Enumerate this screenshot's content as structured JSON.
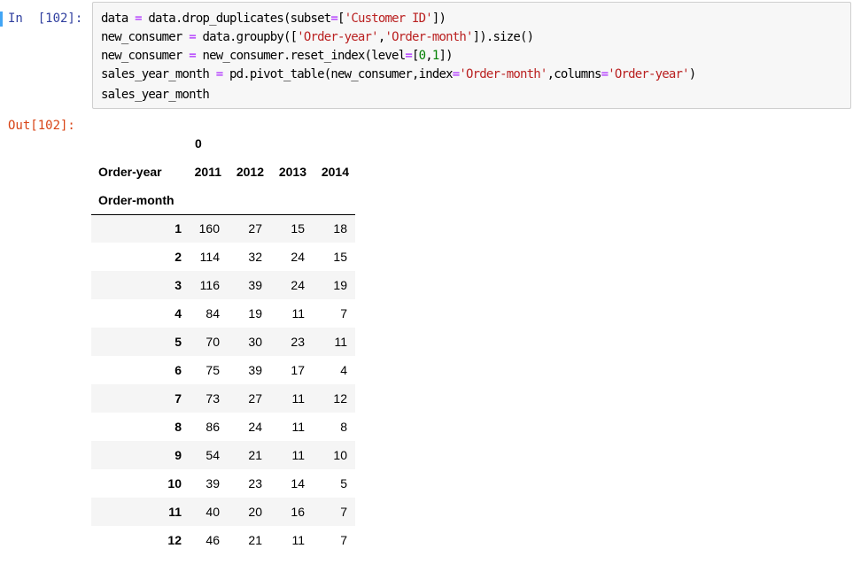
{
  "input_prompt": "In  [102]:",
  "output_prompt": "Out[102]:",
  "code": {
    "line1": {
      "a": "data ",
      "b": "=",
      "c": " data.drop_duplicates(subset",
      "d": "=",
      "e": "[",
      "f": "'Customer ID'",
      "g": "])"
    },
    "line2": {
      "a": "new_consumer ",
      "b": "=",
      "c": " data.groupby([",
      "d": "'Order-year'",
      "e": ",",
      "f": "'Order-month'",
      "g": "]).size()"
    },
    "line3": {
      "a": "new_consumer ",
      "b": "=",
      "c": " new_consumer.reset_index(level",
      "d": "=",
      "e": "[",
      "f": "0",
      "g": ",",
      "h": "1",
      "i": "])"
    },
    "line4": {
      "a": "sales_year_month ",
      "b": "=",
      "c": " pd.pivot_table(new_consumer,index",
      "d": "=",
      "e": "'Order-month'",
      "f": ",columns",
      "g": "=",
      "h": "'Order-year'",
      "i": ")"
    },
    "line5": "sales_year_month"
  },
  "table": {
    "level0_label": "0",
    "columns_name": "Order-year",
    "index_name": "Order-month",
    "columns": [
      "2011",
      "2012",
      "2013",
      "2014"
    ],
    "rows": [
      {
        "idx": "1",
        "v": [
          "160",
          "27",
          "15",
          "18"
        ]
      },
      {
        "idx": "2",
        "v": [
          "114",
          "32",
          "24",
          "15"
        ]
      },
      {
        "idx": "3",
        "v": [
          "116",
          "39",
          "24",
          "19"
        ]
      },
      {
        "idx": "4",
        "v": [
          "84",
          "19",
          "11",
          "7"
        ]
      },
      {
        "idx": "5",
        "v": [
          "70",
          "30",
          "23",
          "11"
        ]
      },
      {
        "idx": "6",
        "v": [
          "75",
          "39",
          "17",
          "4"
        ]
      },
      {
        "idx": "7",
        "v": [
          "73",
          "27",
          "11",
          "12"
        ]
      },
      {
        "idx": "8",
        "v": [
          "86",
          "24",
          "11",
          "8"
        ]
      },
      {
        "idx": "9",
        "v": [
          "54",
          "21",
          "11",
          "10"
        ]
      },
      {
        "idx": "10",
        "v": [
          "39",
          "23",
          "14",
          "5"
        ]
      },
      {
        "idx": "11",
        "v": [
          "40",
          "20",
          "16",
          "7"
        ]
      },
      {
        "idx": "12",
        "v": [
          "46",
          "21",
          "11",
          "7"
        ]
      }
    ]
  },
  "colors": {
    "input_prompt": "#303f9f",
    "output_prompt": "#d84315",
    "cell_marker": "#42a5f5",
    "code_bg": "#f7f7f7",
    "operator": "#aa22ff",
    "string": "#ba2121",
    "number": "#008000"
  }
}
